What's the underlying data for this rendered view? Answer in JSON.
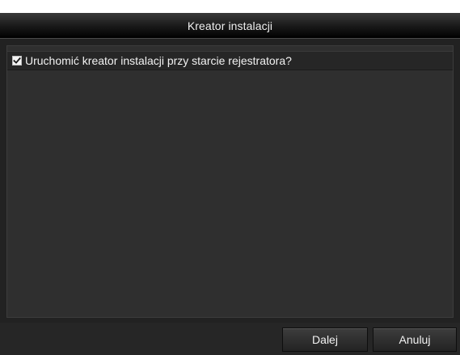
{
  "dialog": {
    "title": "Kreator instalacji",
    "option": {
      "label": "Uruchomić kreator instalacji przy starcie rejestratora?",
      "checked": true
    },
    "buttons": {
      "next_label": "Dalej",
      "cancel_label": "Anuluj"
    }
  },
  "colors": {
    "background": "#222222",
    "titlebar": "#000000",
    "text": "#ffffff"
  },
  "icons": {
    "checkbox": "checkmark-icon"
  }
}
